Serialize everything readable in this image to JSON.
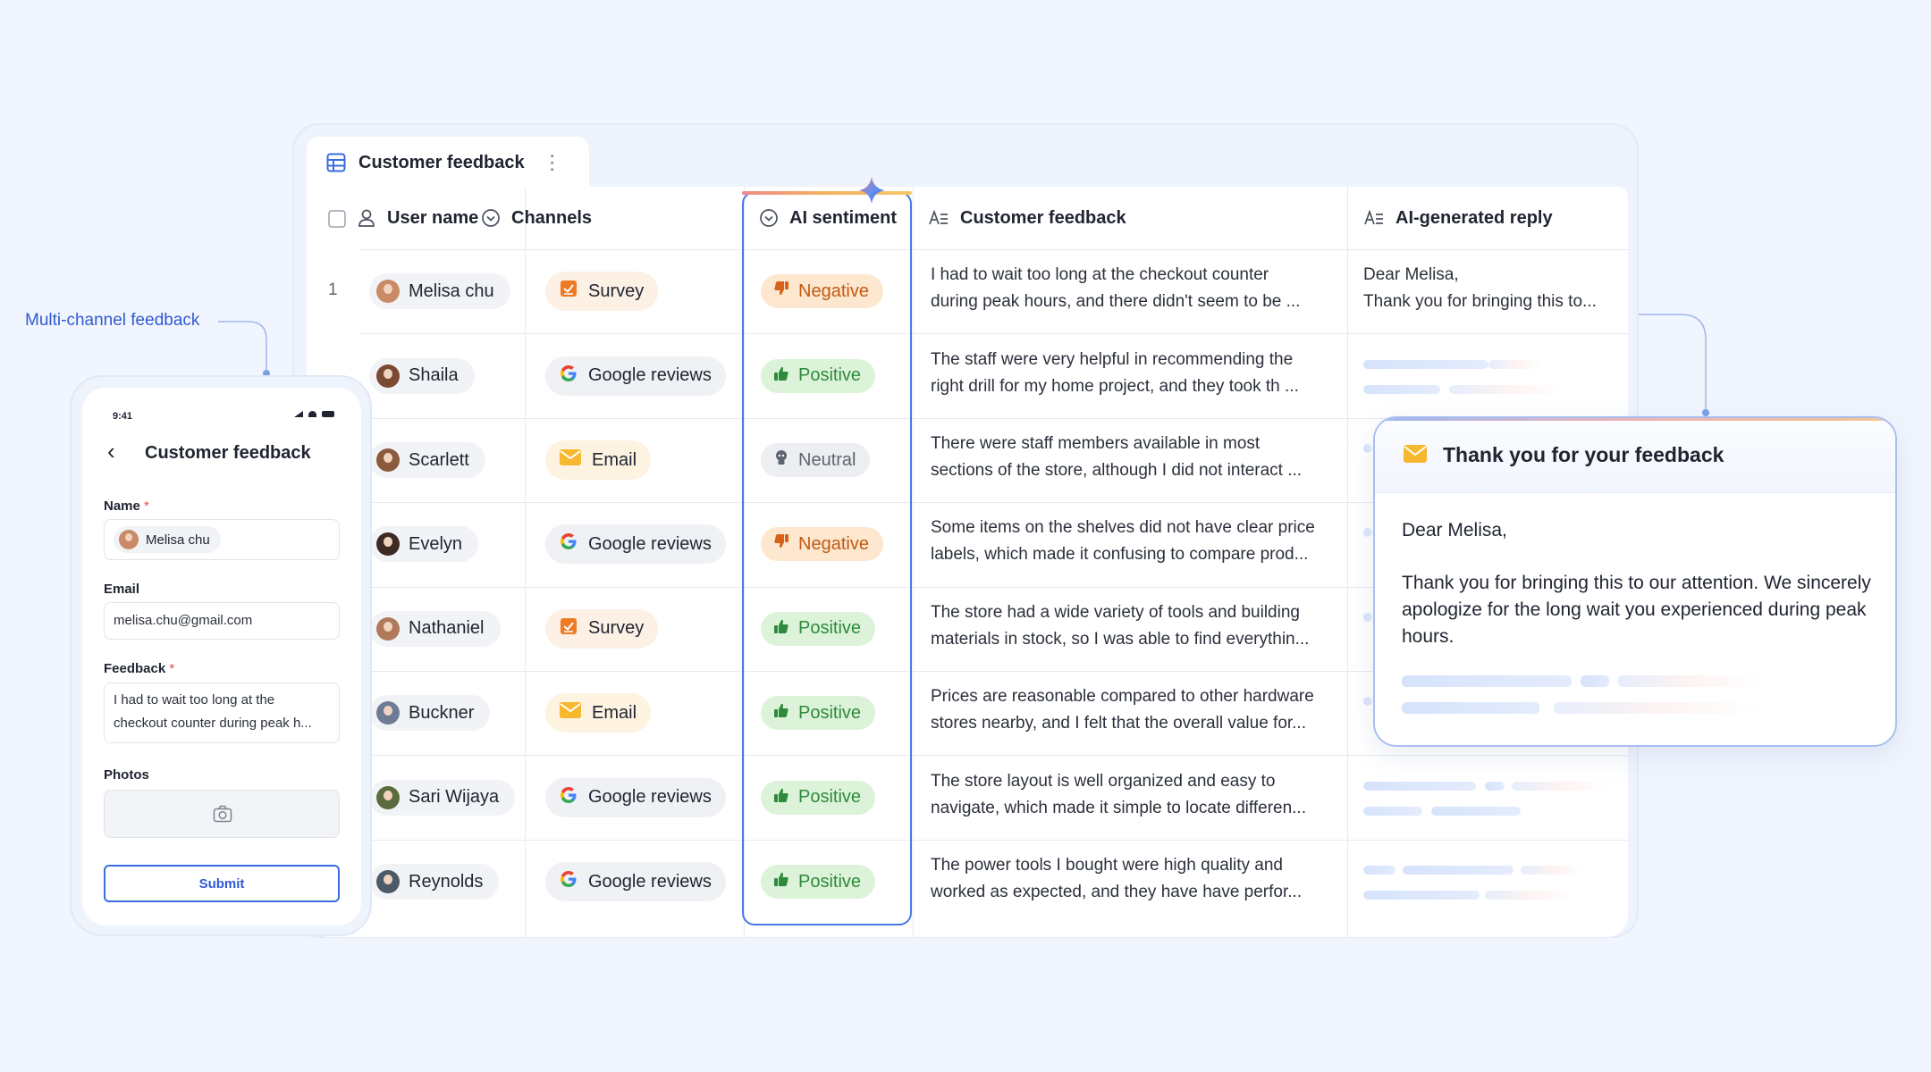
{
  "annotation": {
    "label": "Multi-channel feedback"
  },
  "table": {
    "tab_title": "Customer feedback",
    "columns": [
      {
        "label": "User name",
        "icon": "user-icon"
      },
      {
        "label": "Channels",
        "icon": "chevron-circle-icon"
      },
      {
        "label": "AI sentiment",
        "icon": "chevron-circle-icon"
      },
      {
        "label": "Customer feedback",
        "icon": "text-lines-icon"
      },
      {
        "label": "AI-generated reply",
        "icon": "text-lines-icon"
      }
    ],
    "rows": [
      {
        "num": "1",
        "name": "Melisa chu",
        "channel": "Survey",
        "sentiment": "Negative",
        "feedback1": "I had to wait too long at the checkout counter",
        "feedback2": "during peak hours, and there  didn't seem to be ...",
        "reply1": "Dear Melisa,",
        "reply2": "Thank you for bringing this to..."
      },
      {
        "num": "",
        "name": "Shaila",
        "channel": "Google reviews",
        "sentiment": "Positive",
        "feedback1": "The staff were very helpful in recommending the",
        "feedback2": "right drill for my home project, and they took th ..."
      },
      {
        "num": "",
        "name": "Scarlett",
        "channel": "Email",
        "sentiment": "Neutral",
        "feedback1": "There were staff members available in most",
        "feedback2": "sections of the store, although I did not interact  ..."
      },
      {
        "num": "",
        "name": "Evelyn",
        "channel": "Google reviews",
        "sentiment": "Negative",
        "feedback1": "Some items on the shelves did not have clear price",
        "feedback2": "labels, which made it confusing to compare prod..."
      },
      {
        "num": "",
        "name": "Nathaniel",
        "channel": "Survey",
        "sentiment": "Positive",
        "feedback1": "The store had a wide variety of tools and building",
        "feedback2": "materials in stock, so I was able to find everythin..."
      },
      {
        "num": "",
        "name": "Buckner",
        "channel": "Email",
        "sentiment": "Positive",
        "feedback1": "Prices are reasonable compared to other hardware",
        "feedback2": "stores nearby, and I felt that the overall value for..."
      },
      {
        "num": "",
        "name": "Sari Wijaya",
        "channel": "Google reviews",
        "sentiment": "Positive",
        "feedback1": "The store layout is well organized and easy to",
        "feedback2": "navigate, which made it simple to locate differen..."
      },
      {
        "num": "",
        "name": "Reynolds",
        "channel": "Google reviews",
        "sentiment": "Positive",
        "feedback1": "The power tools I bought were high quality and",
        "feedback2": "worked as expected, and they have have perfor..."
      }
    ]
  },
  "phone": {
    "time": "9:41",
    "title": "Customer feedback",
    "name_label": "Name",
    "name_value": "Melisa chu",
    "email_label": "Email",
    "email_value": "melisa.chu@gmail.com",
    "feedback_label": "Feedback",
    "feedback_line1": "I had to wait too long at the",
    "feedback_line2": "checkout counter during peak h...",
    "photos_label": "Photos",
    "submit_label": "Submit",
    "required_mark": "*"
  },
  "email": {
    "title": "Thank you for your feedback",
    "greeting": "Dear Melisa,",
    "body": "Thank you for bringing this to our attention. We sincerely apologize for the long wait you experienced during peak hours."
  },
  "colors": {
    "accent_blue": "#2f5bd4",
    "negative": "#c25a10",
    "positive": "#2e8a3c",
    "neutral": "#5f6570"
  }
}
